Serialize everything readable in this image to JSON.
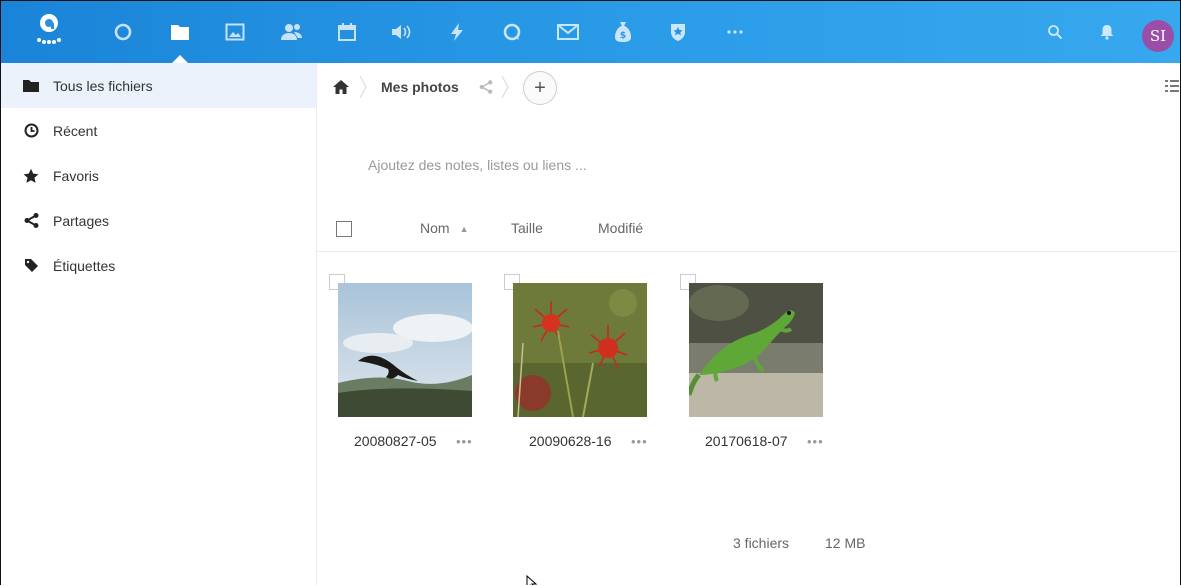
{
  "header": {
    "apps": [
      {
        "name": "logo",
        "icon": "nextcloud-logo-icon"
      },
      {
        "name": "activity",
        "icon": "circle-icon"
      },
      {
        "name": "files",
        "icon": "folder-icon",
        "active": true
      },
      {
        "name": "gallery",
        "icon": "image-icon"
      },
      {
        "name": "contacts",
        "icon": "people-icon"
      },
      {
        "name": "calendar",
        "icon": "calendar-icon"
      },
      {
        "name": "audio",
        "icon": "speaker-icon"
      },
      {
        "name": "flow",
        "icon": "lightning-icon"
      },
      {
        "name": "talk",
        "icon": "search-circle-icon"
      },
      {
        "name": "mail",
        "icon": "mail-icon"
      },
      {
        "name": "money",
        "icon": "money-bag-icon"
      },
      {
        "name": "passwords",
        "icon": "shield-icon"
      },
      {
        "name": "more",
        "icon": "more-icon"
      }
    ],
    "search_icon": "search-icon",
    "notifications_icon": "bell-icon",
    "avatar_initials": "SI",
    "avatar_color": "#9b4ea8",
    "brand_color": "#1a84d8"
  },
  "sidebar": {
    "items": [
      {
        "label": "Tous les fichiers",
        "icon": "folder-icon",
        "active": true
      },
      {
        "label": "Récent",
        "icon": "clock-icon"
      },
      {
        "label": "Favoris",
        "icon": "star-icon"
      },
      {
        "label": "Partages",
        "icon": "share-icon"
      },
      {
        "label": "Étiquettes",
        "icon": "tag-icon"
      }
    ]
  },
  "breadcrumb": {
    "home_icon": "home-icon",
    "current": "Mes photos",
    "add_label": "+"
  },
  "notes": {
    "placeholder": "Ajoutez des notes, listes ou liens ..."
  },
  "table": {
    "columns": {
      "name": "Nom",
      "size": "Taille",
      "modified": "Modifié"
    }
  },
  "files": [
    {
      "name": "20080827-05",
      "more": "•••",
      "thumbnail": "bird-in-flight"
    },
    {
      "name": "20090628-16",
      "more": "•••",
      "thumbnail": "red-sundew-plant"
    },
    {
      "name": "20170618-07",
      "more": "•••",
      "thumbnail": "green-lizard"
    }
  ],
  "summary": {
    "count": "3 fichiers",
    "size": "12 MB"
  }
}
